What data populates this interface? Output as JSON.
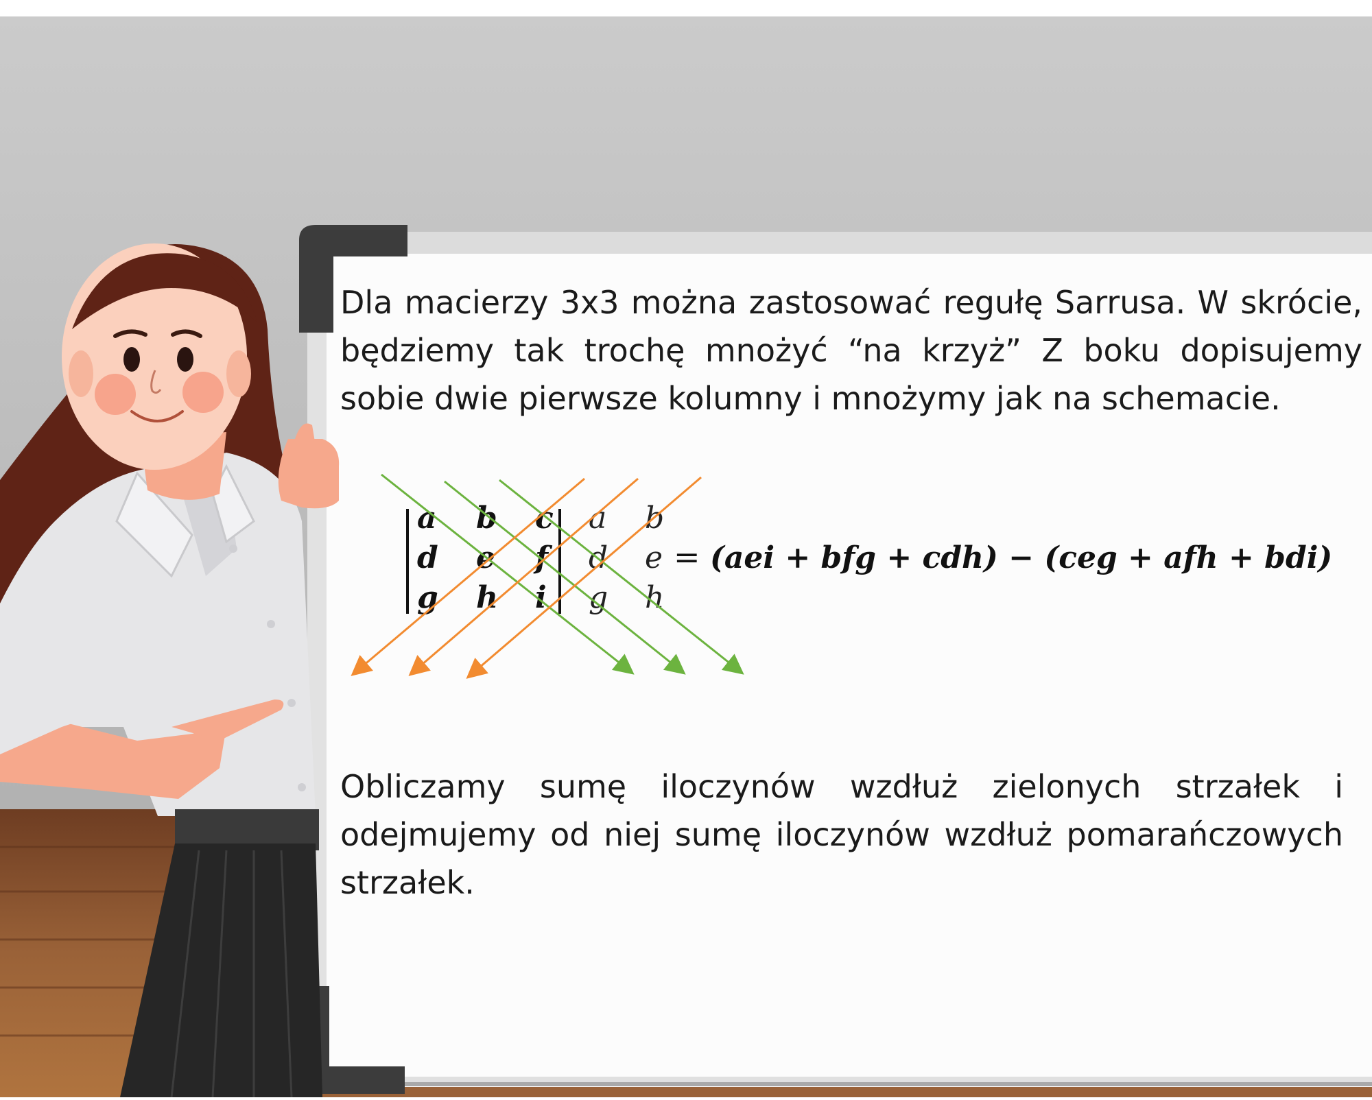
{
  "paragraph_1": "Dla macierzy 3x3 można zastosować regułę Sarrusa. W skrócie, będziemy tak trochę mnożyć “na krzyż” Z boku dopisujemy sobie dwie pierwsze kolumny i mnożymy jak na schemacie.",
  "paragraph_2": "Obliczamy sumę iloczynów wzdłuż zielonych strzałek i odejmujemy od niej sumę iloczynów wzdłuż pomarańczowych strzałek.",
  "formula": {
    "matrix": [
      [
        "a",
        "b",
        "c"
      ],
      [
        "d",
        "e",
        "f"
      ],
      [
        "g",
        "h",
        "i"
      ]
    ],
    "appended": [
      [
        "a",
        "b"
      ],
      [
        "d",
        "e"
      ],
      [
        "g",
        "h"
      ]
    ],
    "equals": "=",
    "result": "(aei + bfg + cdh) − (ceg + afh + bdi)"
  },
  "colors": {
    "green_arrow": "#6cb33f",
    "orange_arrow": "#f28b30",
    "board_frame": "#3c3c3c",
    "wall": "#c8c8c8",
    "floor": "#8a5a32"
  },
  "icons": [
    "teacher-illustration",
    "whiteboard",
    "green-arrow-icon",
    "orange-arrow-icon"
  ]
}
